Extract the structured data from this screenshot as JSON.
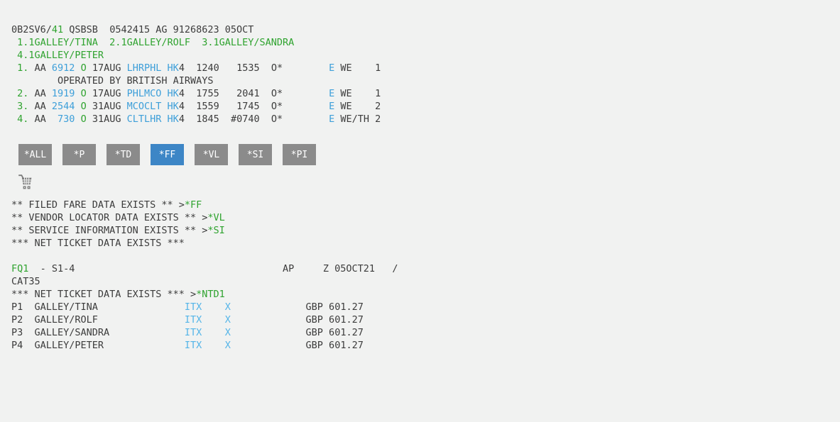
{
  "palette": {
    "background": "#f1f2f1",
    "text_dark": "#3c3c3c",
    "text_green": "#2fa32f",
    "text_blue": "#3d9fd9",
    "text_cyan": "#55b5e8",
    "button_gray": "#8b8b8b",
    "button_active_blue": "#3d86c6",
    "button_text": "#ffffff",
    "icon_gray": "#7d7d7d"
  },
  "toolbar": {
    "buttons": [
      {
        "label": "*ALL",
        "name": "button-all",
        "active": false
      },
      {
        "label": "*P",
        "name": "button-p",
        "active": false
      },
      {
        "label": "*TD",
        "name": "button-td",
        "active": false
      },
      {
        "label": "*FF",
        "name": "button-ff",
        "active": true
      },
      {
        "label": "*VL",
        "name": "button-vl",
        "active": false
      },
      {
        "label": "*SI",
        "name": "button-si",
        "active": false
      },
      {
        "label": "*PI",
        "name": "button-pi",
        "active": false
      }
    ],
    "cart_icon": "shopping-cart-icon"
  },
  "terminal": {
    "pnr_lines": [
      {
        "name": "pnr-header-line",
        "parts": [
          {
            "t": "0B2SV6/",
            "c": "d",
            "n": "record-locator"
          },
          {
            "t": "41",
            "c": "g",
            "n": "record-locator-suffix",
            "link": true
          },
          {
            "t": " QSBSB  0542415 AG 91268623 05OCT",
            "c": "d",
            "n": "pcc-agent-info"
          }
        ]
      },
      {
        "name": "passenger-names-line-1",
        "parts": [
          {
            "t": " ",
            "c": "d"
          },
          {
            "t": "1.1GALLEY/TINA  2.1GALLEY/ROLF  3.1GALLEY/SANDRA",
            "c": "g",
            "n": "passenger-names",
            "link": true
          }
        ]
      },
      {
        "name": "passenger-names-line-2",
        "parts": [
          {
            "t": " ",
            "c": "d"
          },
          {
            "t": "4.1GALLEY/PETER",
            "c": "g",
            "n": "passenger-names",
            "link": true
          }
        ]
      },
      {
        "name": "flight-segment-1",
        "parts": [
          {
            "t": " ",
            "c": "d"
          },
          {
            "t": "1.",
            "c": "g",
            "n": "segment-number",
            "link": true
          },
          {
            "t": " AA ",
            "c": "d",
            "n": "carrier-code"
          },
          {
            "t": "6912",
            "c": "b",
            "n": "flight-number",
            "link": true
          },
          {
            "t": " ",
            "c": "d"
          },
          {
            "t": "O",
            "c": "g",
            "n": "booking-class",
            "link": true
          },
          {
            "t": " 17AUG ",
            "c": "d",
            "n": "departure-date"
          },
          {
            "t": "LHRPHL",
            "c": "b",
            "n": "city-pair",
            "link": true
          },
          {
            "t": " ",
            "c": "d"
          },
          {
            "t": "HK",
            "c": "b",
            "n": "status-code",
            "link": true
          },
          {
            "t": "4  1240   1535  O*        ",
            "c": "d",
            "n": "segment-times"
          },
          {
            "t": "E",
            "c": "b",
            "n": "eticket-indicator",
            "link": true
          },
          {
            "t": " WE    1",
            "c": "d",
            "n": "day-of-week"
          }
        ]
      },
      {
        "name": "operated-by-line",
        "parts": [
          {
            "t": "        OPERATED BY BRITISH AIRWAYS",
            "c": "d",
            "n": "operated-by-text"
          }
        ]
      },
      {
        "name": "flight-segment-2",
        "parts": [
          {
            "t": " ",
            "c": "d"
          },
          {
            "t": "2.",
            "c": "g",
            "n": "segment-number",
            "link": true
          },
          {
            "t": " AA ",
            "c": "d",
            "n": "carrier-code"
          },
          {
            "t": "1919",
            "c": "b",
            "n": "flight-number",
            "link": true
          },
          {
            "t": " ",
            "c": "d"
          },
          {
            "t": "O",
            "c": "g",
            "n": "booking-class",
            "link": true
          },
          {
            "t": " 17AUG ",
            "c": "d",
            "n": "departure-date"
          },
          {
            "t": "PHLMCO",
            "c": "b",
            "n": "city-pair",
            "link": true
          },
          {
            "t": " ",
            "c": "d"
          },
          {
            "t": "HK",
            "c": "b",
            "n": "status-code",
            "link": true
          },
          {
            "t": "4  1755   2041  O*        ",
            "c": "d",
            "n": "segment-times"
          },
          {
            "t": "E",
            "c": "b",
            "n": "eticket-indicator",
            "link": true
          },
          {
            "t": " WE    1",
            "c": "d",
            "n": "day-of-week"
          }
        ]
      },
      {
        "name": "flight-segment-3",
        "parts": [
          {
            "t": " ",
            "c": "d"
          },
          {
            "t": "3.",
            "c": "g",
            "n": "segment-number",
            "link": true
          },
          {
            "t": " AA ",
            "c": "d",
            "n": "carrier-code"
          },
          {
            "t": "2544",
            "c": "b",
            "n": "flight-number",
            "link": true
          },
          {
            "t": " ",
            "c": "d"
          },
          {
            "t": "O",
            "c": "g",
            "n": "booking-class",
            "link": true
          },
          {
            "t": " 31AUG ",
            "c": "d",
            "n": "departure-date"
          },
          {
            "t": "MCOCLT",
            "c": "b",
            "n": "city-pair",
            "link": true
          },
          {
            "t": " ",
            "c": "d"
          },
          {
            "t": "HK",
            "c": "b",
            "n": "status-code",
            "link": true
          },
          {
            "t": "4  1559   1745  O*        ",
            "c": "d",
            "n": "segment-times"
          },
          {
            "t": "E",
            "c": "b",
            "n": "eticket-indicator",
            "link": true
          },
          {
            "t": " WE    2",
            "c": "d",
            "n": "day-of-week"
          }
        ]
      },
      {
        "name": "flight-segment-4",
        "parts": [
          {
            "t": " ",
            "c": "d"
          },
          {
            "t": "4.",
            "c": "g",
            "n": "segment-number",
            "link": true
          },
          {
            "t": " AA  ",
            "c": "d",
            "n": "carrier-code"
          },
          {
            "t": "730",
            "c": "b",
            "n": "flight-number",
            "link": true
          },
          {
            "t": " ",
            "c": "d"
          },
          {
            "t": "O",
            "c": "g",
            "n": "booking-class",
            "link": true
          },
          {
            "t": " 31AUG ",
            "c": "d",
            "n": "departure-date"
          },
          {
            "t": "CLTLHR",
            "c": "b",
            "n": "city-pair",
            "link": true
          },
          {
            "t": " ",
            "c": "d"
          },
          {
            "t": "HK",
            "c": "b",
            "n": "status-code",
            "link": true
          },
          {
            "t": "4  1845  #0740  O*        ",
            "c": "d",
            "n": "segment-times"
          },
          {
            "t": "E",
            "c": "b",
            "n": "eticket-indicator",
            "link": true
          },
          {
            "t": " WE/TH 2",
            "c": "d",
            "n": "day-of-week"
          }
        ]
      }
    ],
    "message_lines": [
      {
        "name": "filed-fare-message",
        "parts": [
          {
            "t": "** FILED FARE DATA EXISTS ** >",
            "c": "d",
            "n": "message-text"
          },
          {
            "t": "*FF",
            "c": "g",
            "n": "command-link-ff",
            "link": true
          }
        ]
      },
      {
        "name": "vendor-locator-message",
        "parts": [
          {
            "t": "** VENDOR LOCATOR DATA EXISTS ** >",
            "c": "d",
            "n": "message-text"
          },
          {
            "t": "*VL",
            "c": "g",
            "n": "command-link-vl",
            "link": true
          }
        ]
      },
      {
        "name": "service-information-message",
        "parts": [
          {
            "t": "** SERVICE INFORMATION EXISTS ** >",
            "c": "d",
            "n": "message-text"
          },
          {
            "t": "*SI",
            "c": "g",
            "n": "command-link-si",
            "link": true
          }
        ]
      },
      {
        "name": "net-ticket-message",
        "parts": [
          {
            "t": "*** NET TICKET DATA EXISTS ***",
            "c": "d",
            "n": "message-text"
          }
        ]
      }
    ],
    "fare_lines": [
      {
        "name": "blank-line",
        "parts": [
          {
            "t": "",
            "c": "d"
          }
        ]
      },
      {
        "name": "fare-quote-line",
        "parts": [
          {
            "t": "FQ1",
            "c": "g",
            "n": "fare-quote-number",
            "link": true
          },
          {
            "t": "  - S1-4                                    AP     Z 05OCT21   /",
            "c": "d",
            "n": "fare-quote-details"
          }
        ]
      },
      {
        "name": "cat35-line",
        "parts": [
          {
            "t": "CAT35",
            "c": "d",
            "n": "cat35-label"
          }
        ]
      },
      {
        "name": "net-ticket-data-line",
        "parts": [
          {
            "t": "*** NET TICKET DATA EXISTS *** >",
            "c": "d",
            "n": "message-text"
          },
          {
            "t": "*NTD1",
            "c": "g",
            "n": "command-link-ntd1",
            "link": true
          }
        ]
      },
      {
        "name": "passenger-fare-row-1",
        "parts": [
          {
            "t": "P1  GALLEY/TINA",
            "c": "d",
            "n": "passenger-fare-name"
          },
          {
            "t": "               ",
            "c": "d"
          },
          {
            "t": "ITX",
            "c": "c",
            "n": "fare-type-link",
            "link": true
          },
          {
            "t": "    ",
            "c": "d"
          },
          {
            "t": "X",
            "c": "c",
            "n": "fare-indicator-link",
            "link": true
          },
          {
            "t": "             GBP 601.27",
            "c": "d",
            "n": "fare-amount"
          }
        ]
      },
      {
        "name": "passenger-fare-row-2",
        "parts": [
          {
            "t": "P2  GALLEY/ROLF",
            "c": "d",
            "n": "passenger-fare-name"
          },
          {
            "t": "               ",
            "c": "d"
          },
          {
            "t": "ITX",
            "c": "c",
            "n": "fare-type-link",
            "link": true
          },
          {
            "t": "    ",
            "c": "d"
          },
          {
            "t": "X",
            "c": "c",
            "n": "fare-indicator-link",
            "link": true
          },
          {
            "t": "             GBP 601.27",
            "c": "d",
            "n": "fare-amount"
          }
        ]
      },
      {
        "name": "passenger-fare-row-3",
        "parts": [
          {
            "t": "P3  GALLEY/SANDRA",
            "c": "d",
            "n": "passenger-fare-name"
          },
          {
            "t": "             ",
            "c": "d"
          },
          {
            "t": "ITX",
            "c": "c",
            "n": "fare-type-link",
            "link": true
          },
          {
            "t": "    ",
            "c": "d"
          },
          {
            "t": "X",
            "c": "c",
            "n": "fare-indicator-link",
            "link": true
          },
          {
            "t": "             GBP 601.27",
            "c": "d",
            "n": "fare-amount"
          }
        ]
      },
      {
        "name": "passenger-fare-row-4",
        "parts": [
          {
            "t": "P4  GALLEY/PETER",
            "c": "d",
            "n": "passenger-fare-name"
          },
          {
            "t": "              ",
            "c": "d"
          },
          {
            "t": "ITX",
            "c": "c",
            "n": "fare-type-link",
            "link": true
          },
          {
            "t": "    ",
            "c": "d"
          },
          {
            "t": "X",
            "c": "c",
            "n": "fare-indicator-link",
            "link": true
          },
          {
            "t": "             GBP 601.27",
            "c": "d",
            "n": "fare-amount"
          }
        ]
      }
    ]
  }
}
